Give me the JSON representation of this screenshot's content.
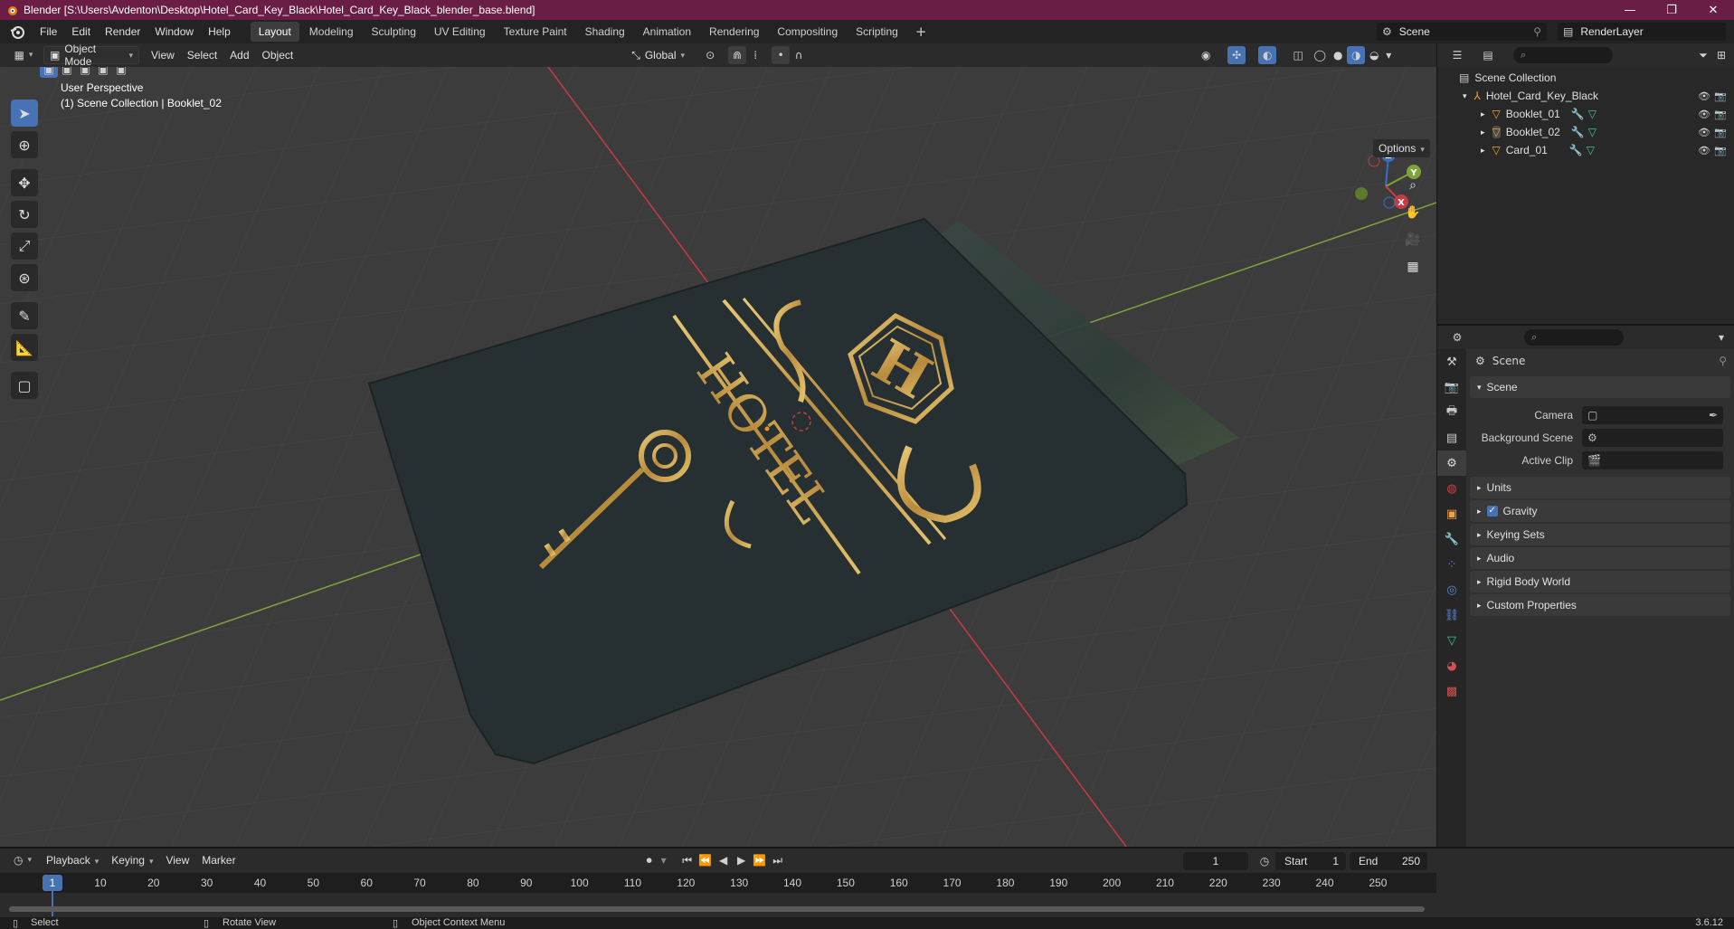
{
  "window": {
    "title": "Blender [S:\\Users\\Avdenton\\Desktop\\Hotel_Card_Key_Black\\Hotel_Card_Key_Black_blender_base.blend]",
    "minimize_icon": "minimize-icon",
    "maximize_icon": "maximize-icon",
    "close_icon": "close-icon"
  },
  "menus": [
    "File",
    "Edit",
    "Render",
    "Window",
    "Help"
  ],
  "workspaces": {
    "active": "Layout",
    "tabs": [
      "Layout",
      "Modeling",
      "Sculpting",
      "UV Editing",
      "Texture Paint",
      "Shading",
      "Animation",
      "Rendering",
      "Compositing",
      "Scripting"
    ]
  },
  "scene_selector": {
    "value": "Scene"
  },
  "view_layer_selector": {
    "value": "RenderLayer"
  },
  "viewport_header": {
    "mode": "Object Mode",
    "menus": [
      "View",
      "Select",
      "Add",
      "Object"
    ],
    "orientation": "Global"
  },
  "viewport": {
    "perspective": "User Perspective",
    "collection_info": "(1) Scene Collection | Booklet_02",
    "options_label": "Options",
    "gizmo": {
      "z": "Z",
      "y": "Y",
      "x": "X"
    },
    "object_texts": {
      "monogram": "H",
      "word": "HOTEL"
    }
  },
  "outliner": {
    "search_placeholder": "",
    "root": "Scene Collection",
    "collection": "Hotel_Card_Key_Black",
    "objects": [
      "Booklet_01",
      "Booklet_02",
      "Card_01"
    ]
  },
  "properties": {
    "context": "Scene",
    "panel_scene": "Scene",
    "fields": [
      {
        "label": "Camera",
        "value": ""
      },
      {
        "label": "Background Scene",
        "value": ""
      },
      {
        "label": "Active Clip",
        "value": ""
      }
    ],
    "panels": [
      "Units",
      "Gravity",
      "Keying Sets",
      "Audio",
      "Rigid Body World",
      "Custom Properties"
    ],
    "gravity_checked": true
  },
  "timeline": {
    "menus": [
      "Playback",
      "Keying",
      "View",
      "Marker"
    ],
    "current_frame": "1",
    "start_label": "Start",
    "start": "1",
    "end_label": "End",
    "end": "250",
    "ticks": [
      "1",
      "10",
      "20",
      "30",
      "40",
      "50",
      "60",
      "70",
      "80",
      "90",
      "100",
      "110",
      "120",
      "130",
      "140",
      "150",
      "160",
      "170",
      "180",
      "190",
      "200",
      "210",
      "220",
      "230",
      "240",
      "250"
    ]
  },
  "statusbar": {
    "select": "Select",
    "rotate": "Rotate View",
    "context_menu": "Object Context Menu",
    "version": "3.6.12"
  },
  "colors": {
    "title_bar": "#6a1d45",
    "accent": "#4772b3",
    "x_axis": "#c83a44",
    "y_axis": "#7ea33a",
    "gold": "#c9a14a",
    "card": "#263033"
  }
}
